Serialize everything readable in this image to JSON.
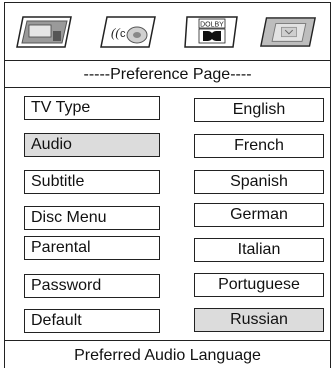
{
  "tabs": [
    {
      "name": "general-setup",
      "icon": "speaker-panel-icon"
    },
    {
      "name": "audio-setup",
      "icon": "surround-sound-icon"
    },
    {
      "name": "dolby-setup",
      "icon": "dolby-logo-icon",
      "label": "DOLBY"
    },
    {
      "name": "preference-setup",
      "icon": "preference-panel-icon",
      "active": true
    }
  ],
  "page_title": "-----Preference Page----",
  "menu_items": [
    "TV Type",
    "Audio",
    "Subtitle",
    "Disc Menu",
    "Parental",
    "Password",
    "Default"
  ],
  "selected_menu_item": "Audio",
  "language_options": [
    "English",
    "French",
    "Spanish",
    "German",
    "Italian",
    "Portuguese",
    "Russian"
  ],
  "selected_language": "Russian",
  "status_text": "Preferred Audio Language",
  "colors": {
    "highlight": "#dcdcdc",
    "border": "#222222",
    "active_tab": "#bdbdbd"
  }
}
